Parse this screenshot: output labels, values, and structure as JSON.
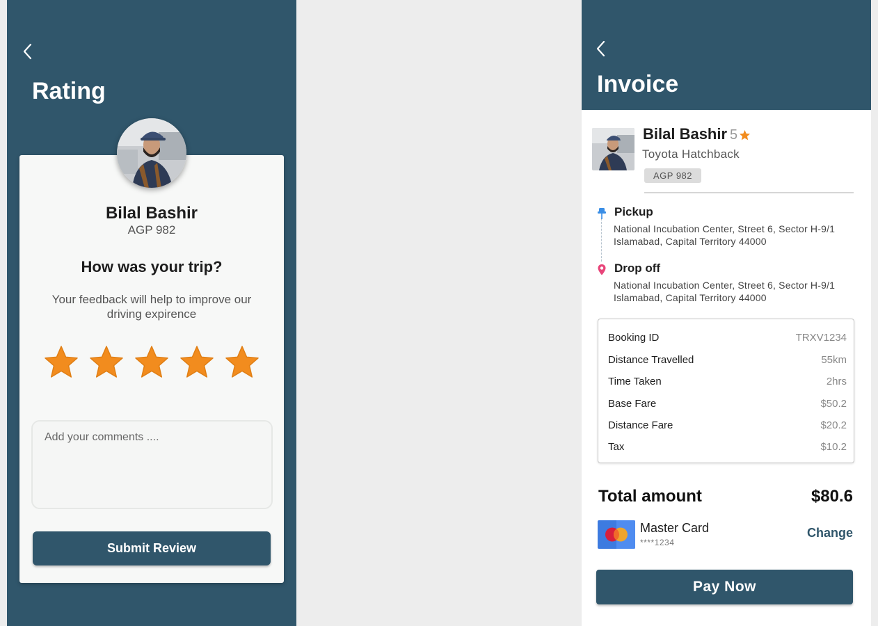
{
  "rating_screen": {
    "title": "Rating",
    "driver": {
      "name": "Bilal Bashir",
      "plate": "AGP 982"
    },
    "question": "How was your trip?",
    "feedback_text": "Your feedback will help to improve our driving expirence",
    "stars": {
      "filled": 5,
      "total": 5,
      "color": "#f28c1e"
    },
    "comments_placeholder": "Add your comments ....",
    "submit_label": "Submit Review"
  },
  "invoice_screen": {
    "title": "Invoice",
    "driver": {
      "name": "Bilal Bashir",
      "rating": "5",
      "car": "Toyota Hatchback",
      "plate": "AGP 982"
    },
    "pickup": {
      "label": "Pickup",
      "address_line1": "National Incubation Center, Street 6, Sector H-9/1",
      "address_line2": "Islamabad, Capital Territory 44000"
    },
    "dropoff": {
      "label": "Drop off",
      "address_line1": "National Incubation Center, Street 6, Sector H-9/1",
      "address_line2": "Islamabad, Capital Territory 44000"
    },
    "details": [
      {
        "label": "Booking ID",
        "value": "TRXV1234"
      },
      {
        "label": "Distance Travelled",
        "value": "55km"
      },
      {
        "label": "Time Taken",
        "value": "2hrs"
      },
      {
        "label": "Base Fare",
        "value": "$50.2"
      },
      {
        "label": "Distance Fare",
        "value": "$20.2"
      },
      {
        "label": "Tax",
        "value": "$10.2"
      }
    ],
    "total_label": "Total amount",
    "total_value": "$80.6",
    "payment": {
      "card_name": "Master Card",
      "card_number": "****1234",
      "change_label": "Change"
    },
    "pay_label": "Pay Now"
  },
  "colors": {
    "primary": "#30566b",
    "star": "#f28c1e",
    "pickup_pin": "#3a8ee6",
    "dropoff_pin": "#e8457a"
  },
  "icons": [
    "back-arrow-icon",
    "star-icon",
    "pickup-pin-icon",
    "dropoff-pin-icon",
    "mastercard-icon"
  ]
}
